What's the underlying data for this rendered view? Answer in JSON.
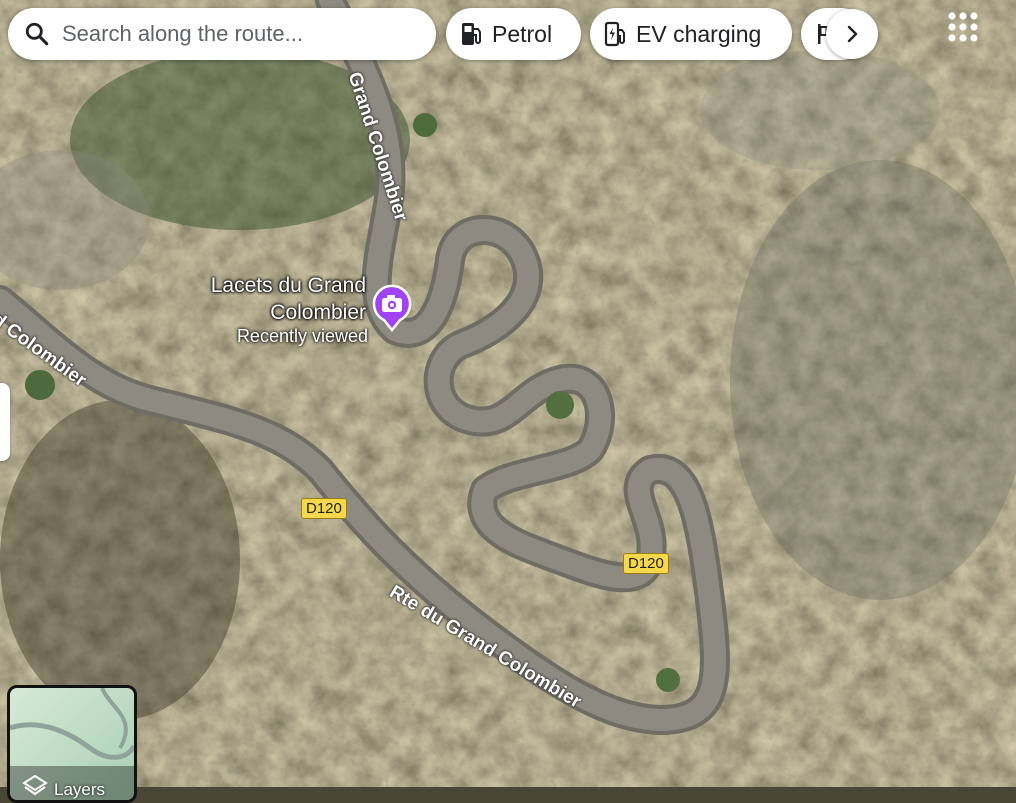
{
  "search": {
    "placeholder": "Search along the route..."
  },
  "chips": [
    {
      "label": "Petrol",
      "icon": "fuel-pump-icon"
    },
    {
      "label": "EV charging",
      "icon": "ev-charger-icon"
    }
  ],
  "place": {
    "name_line1": "Lacets du Grand",
    "name_line2": "Colombier",
    "subtitle": "Recently viewed",
    "icon": "camera-icon",
    "pin_color": "#a142f4"
  },
  "roads": {
    "name_top": "Grand Colombier",
    "name_left": "d Colombier",
    "name_main": "Rte du Grand Colombier",
    "shield_1": "D120",
    "shield_2": "D120"
  },
  "layers": {
    "label": "Layers"
  },
  "colors": {
    "shield": "#f6d84b",
    "road": "#8d8a82"
  }
}
